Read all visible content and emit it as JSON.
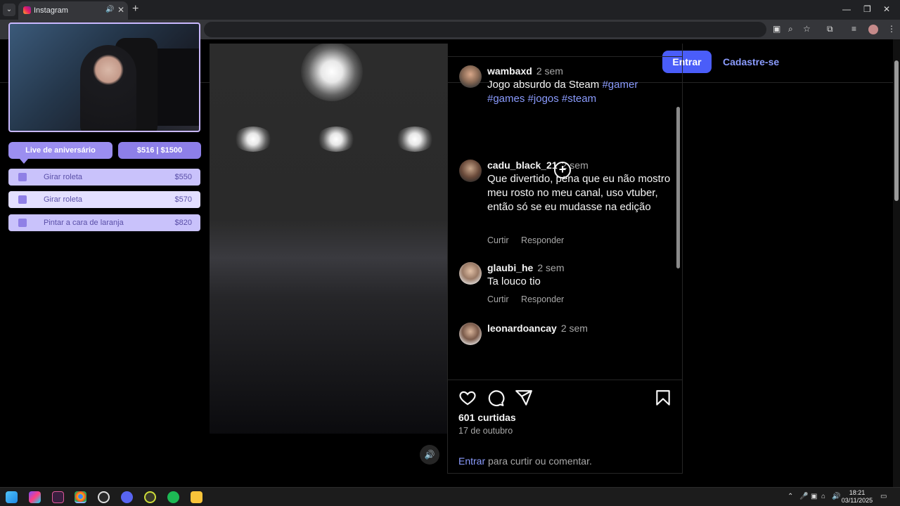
{
  "browser": {
    "tab_title": "Instagram",
    "new_tab_glyph": "+",
    "close_glyph": "✕",
    "audio_icon": "speaker-icon",
    "window_controls": [
      "—",
      "❐",
      "✕"
    ]
  },
  "header": {
    "login_label": "Entrar",
    "signup_label": "Cadastre-se"
  },
  "post": {
    "author": {
      "username": "wambaxd",
      "time": "2 sem",
      "caption": "Jogo absurdo da Steam",
      "hashtags": [
        "#gamer",
        "#games",
        "#jogos",
        "#steam"
      ]
    },
    "comments": [
      {
        "username": "cadu_black_21",
        "time": "2 sem",
        "text": "Que divertido, pena que eu não mostro meu rosto no meu canal, uso vtuber, então só se eu mudasse na edição",
        "like_label": "Curtir",
        "reply_label": "Responder"
      },
      {
        "username": "glaubi_he",
        "time": "2 sem",
        "text": "Ta louco tio",
        "like_label": "Curtir",
        "reply_label": "Responder"
      },
      {
        "username": "leonardoancay",
        "time": "2 sem"
      }
    ],
    "likes": "601 curtidas",
    "date": "17 de outubro",
    "login_link": "Entrar",
    "login_prompt": "para curtir ou comentar."
  },
  "overlay": {
    "event_label": "Live de aniversário",
    "goal_label": "$516 | $1500",
    "rewards": [
      {
        "name": "Girar roleta",
        "price": "$550"
      },
      {
        "name": "Girar roleta",
        "price": "$570"
      },
      {
        "name": "Pintar a cara de laranja",
        "price": "$820"
      }
    ]
  },
  "taskbar": {
    "time": "18:21",
    "date": "03/11/2025"
  },
  "colors": {
    "accent": "#4a5df9",
    "link": "#8b9cff",
    "overlay_purple": "#9b8ef0"
  }
}
